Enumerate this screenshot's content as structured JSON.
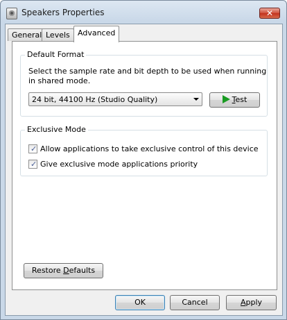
{
  "window": {
    "title": "Speakers Properties",
    "close_label": "✕"
  },
  "tabs": [
    {
      "label": "General"
    },
    {
      "label": "Levels"
    },
    {
      "label": "Advanced",
      "selected": true
    }
  ],
  "default_format": {
    "title": "Default Format",
    "description": "Select the sample rate and bit depth to be used when running in shared mode.",
    "selected_format": "24 bit, 44100 Hz (Studio Quality)",
    "test_button": {
      "mnemonic": "T",
      "rest": "est",
      "icon": "play-icon"
    }
  },
  "exclusive_mode": {
    "title": "Exclusive Mode",
    "options": [
      {
        "label": "Allow applications to take exclusive control of this device",
        "checked": true
      },
      {
        "label": "Give exclusive mode applications priority",
        "checked": true
      }
    ]
  },
  "restore_defaults": {
    "before": "Restore ",
    "mnemonic": "D",
    "after": "efaults"
  },
  "footer": {
    "ok_label": "OK",
    "cancel_label": "Cancel",
    "apply_mnemonic": "A",
    "apply_rest": "pply"
  },
  "colors": {
    "accent_border": "#3c7fb1",
    "play_icon": "#199b22",
    "close_button": "#c3321e"
  }
}
